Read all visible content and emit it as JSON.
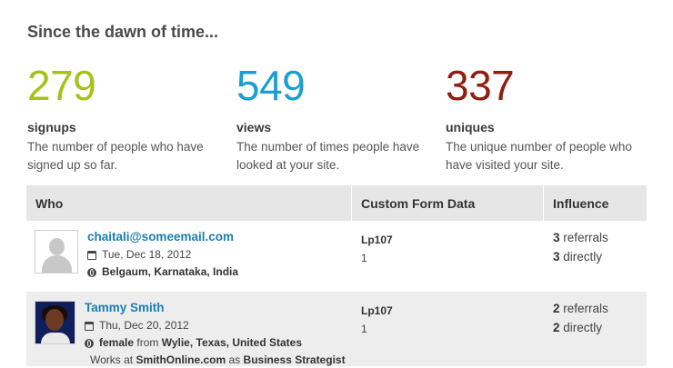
{
  "heading": "Since the dawn of time...",
  "stats": [
    {
      "number": "279",
      "name": "signups",
      "description": "The number of people who have signed up so far.",
      "color": "#a5c21a"
    },
    {
      "number": "549",
      "name": "views",
      "description": "The number of times people have looked at your site.",
      "color": "#1a9fd0"
    },
    {
      "number": "337",
      "name": "uniques",
      "description": "The unique number of people who have visited your site.",
      "color": "#8e1f12"
    }
  ],
  "table": {
    "headers": {
      "who": "Who",
      "custom": "Custom Form Data",
      "influence": "Influence"
    },
    "rows": [
      {
        "name": "chaitali@someemail.com",
        "avatar": "placeholder-avatar-icon",
        "date": "Tue, Dec 18, 2012",
        "location": "Belgaum, Karnataka, India",
        "field": "Lp107",
        "value": "1",
        "referrals_num": "3",
        "referrals_label": "referrals",
        "directly_num": "3",
        "directly_label": "directly"
      },
      {
        "name": "Tammy Smith",
        "avatar": "photo-avatar",
        "date": "Thu, Dec 20, 2012",
        "gender": "female",
        "from_label": "from",
        "location": "Wylie, Texas, United States",
        "works_prefix": "Works at",
        "company": "SmithOnline.com",
        "as_label": "as",
        "job": "Business Strategist",
        "field": "Lp107",
        "value": "1",
        "referrals_num": "2",
        "referrals_label": "referrals",
        "directly_num": "2",
        "directly_label": "directly"
      }
    ]
  }
}
